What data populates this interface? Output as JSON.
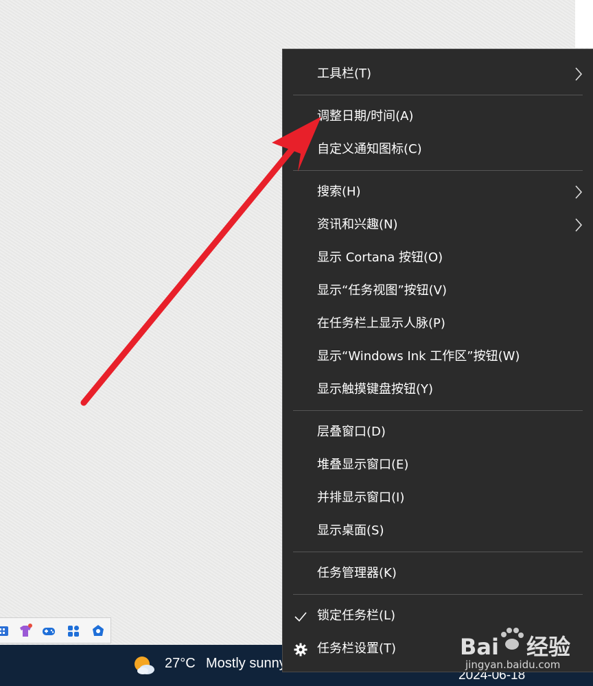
{
  "menu": {
    "items": [
      {
        "label": "工具栏(T)",
        "submenu": true
      },
      {
        "label": "调整日期/时间(A)"
      },
      {
        "label": "自定义通知图标(C)"
      },
      {
        "label": "搜索(H)",
        "submenu": true
      },
      {
        "label": "资讯和兴趣(N)",
        "submenu": true
      },
      {
        "label": "显示 Cortana 按钮(O)"
      },
      {
        "label": "显示“任务视图”按钮(V)"
      },
      {
        "label": "在任务栏上显示人脉(P)"
      },
      {
        "label": "显示“Windows Ink 工作区”按钮(W)"
      },
      {
        "label": "显示触摸键盘按钮(Y)"
      },
      {
        "label": "层叠窗口(D)"
      },
      {
        "label": "堆叠显示窗口(E)"
      },
      {
        "label": "并排显示窗口(I)"
      },
      {
        "label": "显示桌面(S)"
      },
      {
        "label": "任务管理器(K)"
      },
      {
        "label": "锁定任务栏(L)",
        "checked": true
      },
      {
        "label": "任务栏设置(T)",
        "icon": "gear-icon"
      }
    ]
  },
  "taskbar": {
    "temperature": "27°C",
    "condition": "Mostly sunny",
    "date": "2024-06-18"
  },
  "tray": {
    "icons": [
      "keyboard-icon",
      "tshirt-icon",
      "gamepad-icon",
      "apps-grid-icon",
      "pen-app-icon"
    ]
  },
  "watermark": {
    "brand": "Bai",
    "brand_cn": "经验",
    "url": "jingyan.baidu.com"
  },
  "colors": {
    "menu_bg": "#2b2b2b",
    "taskbar_bg": "#10233a",
    "annotation_arrow": "#e8202a"
  }
}
